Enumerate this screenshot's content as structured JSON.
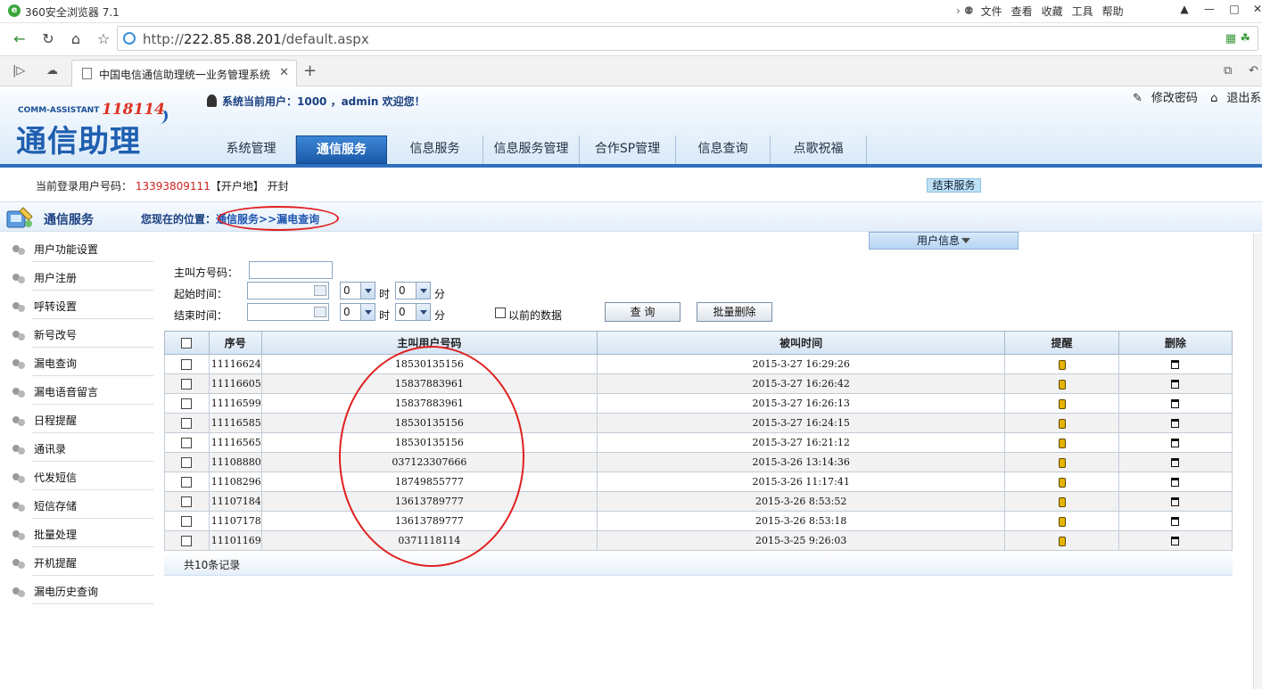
{
  "browser": {
    "app_title": "360安全浏览器 7.1",
    "menus": [
      "文件",
      "查看",
      "收藏",
      "工具",
      "帮助"
    ],
    "url_prefix": "http://",
    "url_host": "222.85.88.201",
    "url_path": "/default.aspx",
    "tab_title": "中国电信通信助理统一业务管理系统"
  },
  "header": {
    "brand_en": "COMM-ASSISTANT",
    "brand_num": "118114",
    "brand_cn": "通信助理",
    "current_user": "系统当前用户：1000 ，admin 欢迎您！",
    "change_password": "修改密码",
    "logout": "退出系统",
    "nav": [
      "系统管理",
      "通信服务",
      "信息服务",
      "信息服务管理",
      "合作SP管理",
      "信息查询",
      "点歌祝福"
    ],
    "nav_active_index": 1
  },
  "infostrip": {
    "label": "当前登录用户号码：",
    "phone": "13393809111",
    "region": "【开户地】 开封",
    "end_service": "结束服务"
  },
  "section": {
    "title": "通信服务",
    "location_label": "您现在的位置：",
    "location_path": "通信服务>>漏电查询"
  },
  "sidebar": {
    "items": [
      "用户功能设置",
      "用户注册",
      "呼转设置",
      "新号改号",
      "漏电查询",
      "漏电语音留言",
      "日程提醒",
      "通讯录",
      "代发短信",
      "短信存储",
      "批量处理",
      "开机提醒",
      "漏电历史查询"
    ]
  },
  "form": {
    "user_info_tab": "用户信息",
    "caller_label": "主叫方号码：",
    "caller_value": "",
    "start_label": "起始时间：",
    "end_label": "结束时间：",
    "hour_value": "0",
    "minute_value": "0",
    "hour_unit": "时",
    "minute_unit": "分",
    "previous_data_label": "以前的数据",
    "query_button": "查 询",
    "batch_delete_button": "批量删除"
  },
  "table": {
    "headers": [
      "序号",
      "主叫用户号码",
      "被叫时间",
      "提醒",
      "删除"
    ],
    "rows": [
      {
        "seq": "11116624",
        "caller": "18530135156",
        "time": "2015-3-27 16:29:26"
      },
      {
        "seq": "11116605",
        "caller": "15837883961",
        "time": "2015-3-27 16:26:42"
      },
      {
        "seq": "11116599",
        "caller": "15837883961",
        "time": "2015-3-27 16:26:13"
      },
      {
        "seq": "11116585",
        "caller": "18530135156",
        "time": "2015-3-27 16:24:15"
      },
      {
        "seq": "11116565",
        "caller": "18530135156",
        "time": "2015-3-27 16:21:12"
      },
      {
        "seq": "11108880",
        "caller": "037123307666",
        "time": "2015-3-26 13:14:36"
      },
      {
        "seq": "11108296",
        "caller": "18749855777",
        "time": "2015-3-26 11:17:41"
      },
      {
        "seq": "11107184",
        "caller": "13613789777",
        "time": "2015-3-26 8:53:52"
      },
      {
        "seq": "11107178",
        "caller": "13613789777",
        "time": "2015-3-26 8:53:18"
      },
      {
        "seq": "11101169",
        "caller": "0371118114",
        "time": "2015-3-25 9:26:03"
      }
    ],
    "total": "共10条记录"
  }
}
